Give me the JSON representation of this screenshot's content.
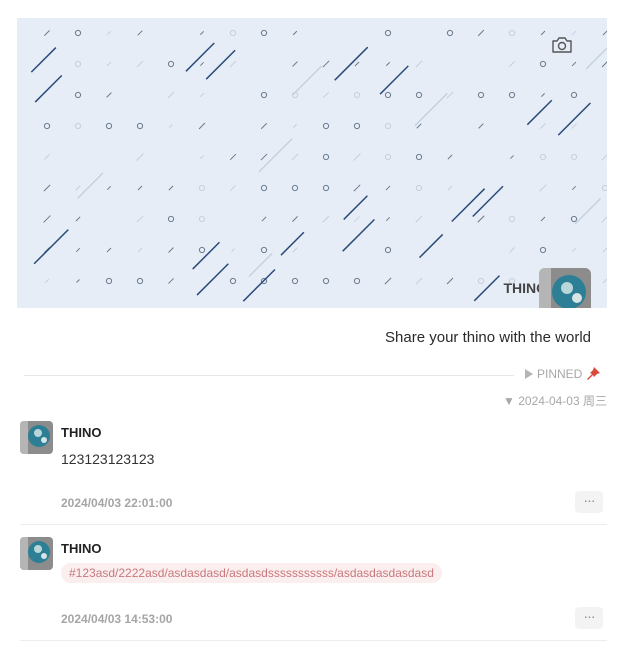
{
  "header": {
    "username": "THINO",
    "slogan": "Share your thino with the world",
    "camera_icon": "camera-icon",
    "avatar": "globe-avatar",
    "cover_colors": {
      "background": "#e6edf6",
      "line": "#2a4a7a",
      "faint": "#c5d0dd",
      "dot": "#6a7a90"
    }
  },
  "pinned": {
    "label": "PINNED",
    "arrow_icon": "triangle-right-icon",
    "pin_icon": "pushpin-icon"
  },
  "date_group": {
    "arrow": "▼",
    "date": "2024-04-03",
    "weekday": "周三"
  },
  "memos": [
    {
      "user": "THINO",
      "content": "123123123123",
      "time": "2024/04/03 22:01:00",
      "more_label": "···"
    },
    {
      "user": "THINO",
      "tag": "#123asd/2222asd/asdasdasd/asdasdsssssssssss/asdasdasdasdasd",
      "time": "2024/04/03 14:53:00",
      "more_label": "···"
    }
  ]
}
